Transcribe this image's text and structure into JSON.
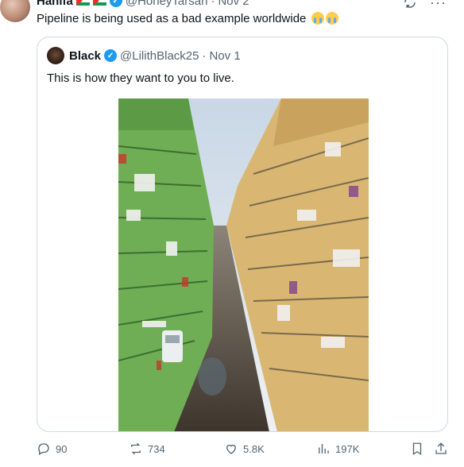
{
  "tweet": {
    "author_name": "Hanifa",
    "author_handle": "@HoneyTarsan",
    "date": "Nov 2",
    "text": "Pipeline is being used as a bad example worldwide",
    "emojis": [
      "loudly-crying-face",
      "loudly-crying-face"
    ]
  },
  "quote": {
    "author_name": "Black",
    "author_handle": "@LilithBlack25",
    "date": "Nov 1",
    "text": "This is how they want to you to live."
  },
  "separator": "·",
  "icons": {
    "verified": "verified-badge-icon",
    "more": "more-options-icon",
    "grok": "grok-icon",
    "flag": "palestine-flag-icon"
  },
  "actions": {
    "replies": "90",
    "reposts": "734",
    "likes": "5.8K",
    "views": "197K"
  },
  "colors": {
    "accent": "#1d9bf0",
    "muted_text": "#536471",
    "border": "#cfd9de"
  }
}
